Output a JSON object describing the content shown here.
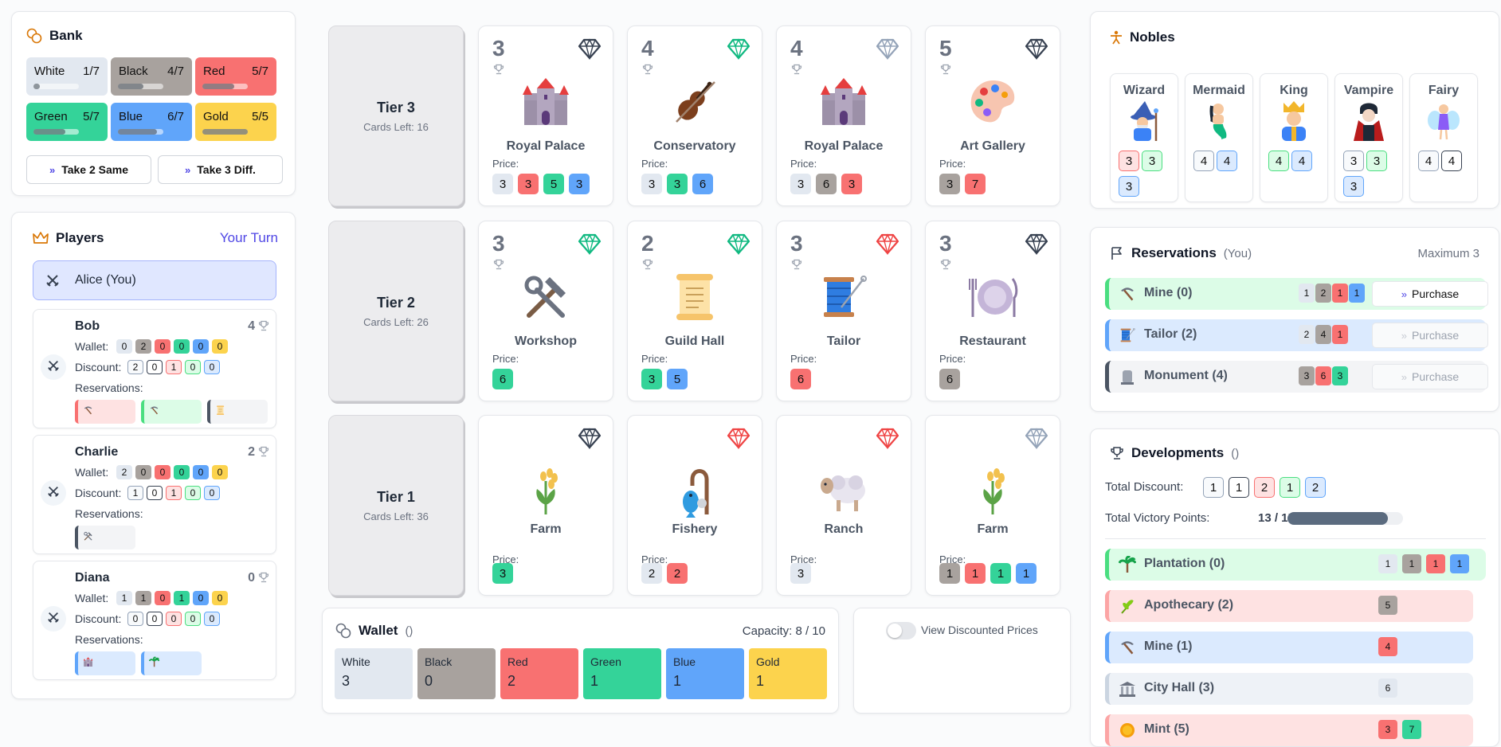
{
  "bank": {
    "title": "Bank",
    "gems": [
      {
        "name": "White",
        "count": "1/7",
        "color": "white",
        "fill": 0.14
      },
      {
        "name": "Black",
        "count": "4/7",
        "color": "black",
        "fill": 0.57
      },
      {
        "name": "Red",
        "count": "5/7",
        "color": "red",
        "fill": 0.71
      },
      {
        "name": "Green",
        "count": "5/7",
        "color": "green",
        "fill": 0.71
      },
      {
        "name": "Blue",
        "count": "6/7",
        "color": "blue",
        "fill": 0.86
      },
      {
        "name": "Gold",
        "count": "5/5",
        "color": "gold",
        "fill": 1.0
      }
    ],
    "take_same_label": "Take 2 Same",
    "take_diff_label": "Take 3 Diff."
  },
  "players": {
    "title": "Players",
    "turn_label": "Your Turn",
    "current": "Alice (You)",
    "wallet_label": "Wallet:",
    "discount_label": "Discount:",
    "reservations_label": "Reservations:",
    "list": [
      {
        "name": "Bob",
        "points": "4",
        "wallet": [
          "0",
          "2",
          "0",
          "0",
          "0",
          "0"
        ],
        "discount": [
          "2",
          "0",
          "1",
          "0",
          "0"
        ]
      },
      {
        "name": "Charlie",
        "points": "2",
        "wallet": [
          "2",
          "0",
          "0",
          "0",
          "0",
          "0"
        ],
        "discount": [
          "1",
          "0",
          "1",
          "0",
          "0"
        ]
      },
      {
        "name": "Diana",
        "points": "0",
        "wallet": [
          "1",
          "1",
          "0",
          "1",
          "0",
          "0"
        ],
        "discount": [
          "0",
          "0",
          "0",
          "0",
          "0"
        ]
      }
    ]
  },
  "tiers": [
    {
      "name": "Tier 3",
      "left": "Cards Left: 16"
    },
    {
      "name": "Tier 2",
      "left": "Cards Left: 26"
    },
    {
      "name": "Tier 1",
      "left": "Cards Left: 36"
    }
  ],
  "price_label": "Price:",
  "cards": [
    [
      {
        "points": "3",
        "name": "Royal Palace",
        "gem": "black",
        "icon": "castle-icon",
        "prices": [
          [
            "white",
            "3"
          ],
          [
            "red",
            "3"
          ],
          [
            "green",
            "5"
          ],
          [
            "blue",
            "3"
          ]
        ]
      },
      {
        "points": "4",
        "name": "Conservatory",
        "gem": "green",
        "icon": "violin-icon",
        "prices": [
          [
            "white",
            "3"
          ],
          [
            "green",
            "3"
          ],
          [
            "blue",
            "6"
          ]
        ]
      },
      {
        "points": "4",
        "name": "Royal Palace",
        "gem": "white",
        "icon": "castle-icon",
        "prices": [
          [
            "white",
            "3"
          ],
          [
            "black",
            "6"
          ],
          [
            "red",
            "3"
          ]
        ]
      },
      {
        "points": "5",
        "name": "Art Gallery",
        "gem": "black",
        "icon": "palette-icon",
        "prices": [
          [
            "black",
            "3"
          ],
          [
            "red",
            "7"
          ]
        ]
      }
    ],
    [
      {
        "points": "3",
        "name": "Workshop",
        "gem": "green",
        "icon": "tools-icon",
        "prices": [
          [
            "green",
            "6"
          ]
        ]
      },
      {
        "points": "2",
        "name": "Guild Hall",
        "gem": "green",
        "icon": "scroll-icon",
        "prices": [
          [
            "green",
            "3"
          ],
          [
            "blue",
            "5"
          ]
        ]
      },
      {
        "points": "3",
        "name": "Tailor",
        "gem": "red",
        "icon": "thread-icon",
        "prices": [
          [
            "red",
            "6"
          ]
        ]
      },
      {
        "points": "3",
        "name": "Restaurant",
        "gem": "black",
        "icon": "plate-icon",
        "prices": [
          [
            "black",
            "6"
          ]
        ]
      }
    ],
    [
      {
        "points": "",
        "name": "Farm",
        "gem": "black",
        "icon": "wheat-icon",
        "prices": [
          [
            "green",
            "3"
          ]
        ]
      },
      {
        "points": "",
        "name": "Fishery",
        "gem": "red",
        "icon": "fishing-icon",
        "prices": [
          [
            "white",
            "2"
          ],
          [
            "red",
            "2"
          ]
        ]
      },
      {
        "points": "",
        "name": "Ranch",
        "gem": "red",
        "icon": "sheep-icon",
        "prices": [
          [
            "white",
            "3"
          ]
        ]
      },
      {
        "points": "",
        "name": "Farm",
        "gem": "white",
        "icon": "wheat-icon",
        "prices": [
          [
            "black",
            "1"
          ],
          [
            "red",
            "1"
          ],
          [
            "green",
            "1"
          ],
          [
            "blue",
            "1"
          ]
        ]
      }
    ]
  ],
  "wallet": {
    "title": "Wallet",
    "paren": "()",
    "capacity": "Capacity: 8 / 10",
    "gems": [
      {
        "name": "White",
        "value": "3",
        "color": "white"
      },
      {
        "name": "Black",
        "value": "0",
        "color": "black"
      },
      {
        "name": "Red",
        "value": "2",
        "color": "red"
      },
      {
        "name": "Green",
        "value": "1",
        "color": "green"
      },
      {
        "name": "Blue",
        "value": "1",
        "color": "blue"
      },
      {
        "name": "Gold",
        "value": "1",
        "color": "gold"
      }
    ]
  },
  "toggle_label": "View Discounted Prices",
  "nobles": {
    "title": "Nobles",
    "list": [
      {
        "name": "Wizard",
        "icon": "wizard-icon",
        "req": [
          [
            "red",
            "3"
          ],
          [
            "green",
            "3"
          ],
          [
            "blue",
            "3"
          ]
        ]
      },
      {
        "name": "Mermaid",
        "icon": "mermaid-icon",
        "req": [
          [
            "white",
            "4"
          ],
          [
            "blue",
            "4"
          ]
        ]
      },
      {
        "name": "King",
        "icon": "king-icon",
        "req": [
          [
            "green",
            "4"
          ],
          [
            "blue",
            "4"
          ]
        ]
      },
      {
        "name": "Vampire",
        "icon": "vampire-icon",
        "req": [
          [
            "white",
            "3"
          ],
          [
            "green",
            "3"
          ],
          [
            "blue",
            "3"
          ]
        ]
      },
      {
        "name": "Fairy",
        "icon": "fairy-icon",
        "req": [
          [
            "white",
            "4"
          ],
          [
            "black",
            "4"
          ]
        ]
      }
    ]
  },
  "reservations": {
    "title": "Reservations",
    "sub": "(You)",
    "max": "Maximum 3",
    "purchase_label": "Purchase",
    "list": [
      {
        "name": "Mine (0)",
        "tone": "green",
        "icon": "pick-icon",
        "tokens": [
          [
            "white",
            "1"
          ],
          [
            "black",
            "2"
          ],
          [
            "red",
            "1"
          ],
          [
            "blue",
            "1"
          ]
        ]
      },
      {
        "name": "Tailor (2)",
        "tone": "blue",
        "icon": "thread-icon",
        "tokens": [
          [
            "white",
            "2"
          ],
          [
            "black",
            "4"
          ],
          [
            "red",
            "1"
          ]
        ]
      },
      {
        "name": "Monument (4)",
        "tone": "black",
        "icon": "monument-icon",
        "tokens": [
          [
            "black",
            "3"
          ],
          [
            "red",
            "6"
          ],
          [
            "green",
            "3"
          ]
        ]
      }
    ]
  },
  "developments": {
    "title": "Developments",
    "paren": "()",
    "discount_label": "Total Discount:",
    "discount": [
      [
        "white",
        "1"
      ],
      [
        "black",
        "1"
      ],
      [
        "red",
        "2"
      ],
      [
        "green",
        "1"
      ],
      [
        "blue",
        "2"
      ]
    ],
    "vp_label": "Total Victory Points:",
    "vp_value": "13 / 15",
    "vp_fill": 0.87,
    "list": [
      {
        "name": "Plantation (0)",
        "tone": "green",
        "icon": "palm-icon",
        "tokens": [
          [
            "white",
            "1"
          ],
          [
            "black",
            "1"
          ],
          [
            "red",
            "1"
          ],
          [
            "blue",
            "1"
          ]
        ]
      },
      {
        "name": "Apothecary (2)",
        "tone": "red",
        "icon": "herb-icon",
        "tokens": [
          [
            "black",
            "5"
          ]
        ]
      },
      {
        "name": "Mine (1)",
        "tone": "blue",
        "icon": "pick-icon",
        "tokens": [
          [
            "red",
            "4"
          ]
        ]
      },
      {
        "name": "City Hall (3)",
        "tone": "white",
        "icon": "building-icon",
        "tokens": [
          [
            "white",
            "6"
          ]
        ]
      },
      {
        "name": "Mint (5)",
        "tone": "red",
        "icon": "coin-icon",
        "tokens": [
          [
            "red",
            "3"
          ],
          [
            "green",
            "7"
          ]
        ]
      }
    ]
  }
}
